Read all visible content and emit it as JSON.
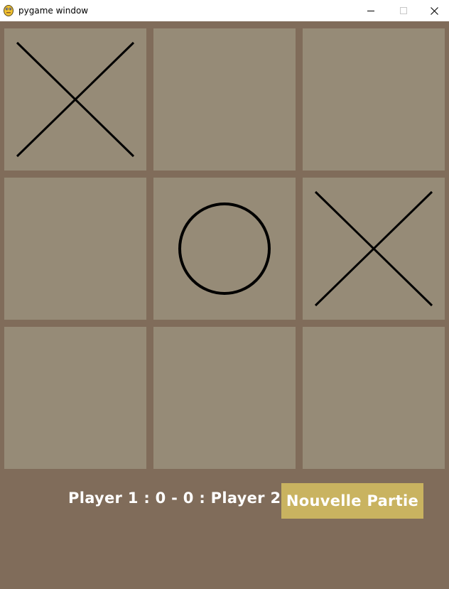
{
  "window": {
    "title": "pygame window",
    "icon": "pygame-snake-icon",
    "controls": [
      "minimize-icon",
      "maximize-icon",
      "close-icon"
    ]
  },
  "colors": {
    "background": "#806c5a",
    "cell": "#968b77",
    "mark": "#000000",
    "button": "#c9b360",
    "text": "#ffffff"
  },
  "board": {
    "cells": [
      "X",
      "",
      "",
      "",
      "O",
      "X",
      "",
      "",
      ""
    ]
  },
  "scoreboard": {
    "text": "Player 1 : 0 - 0 : Player 2"
  },
  "new_game_button": {
    "label": "Nouvelle Partie"
  }
}
